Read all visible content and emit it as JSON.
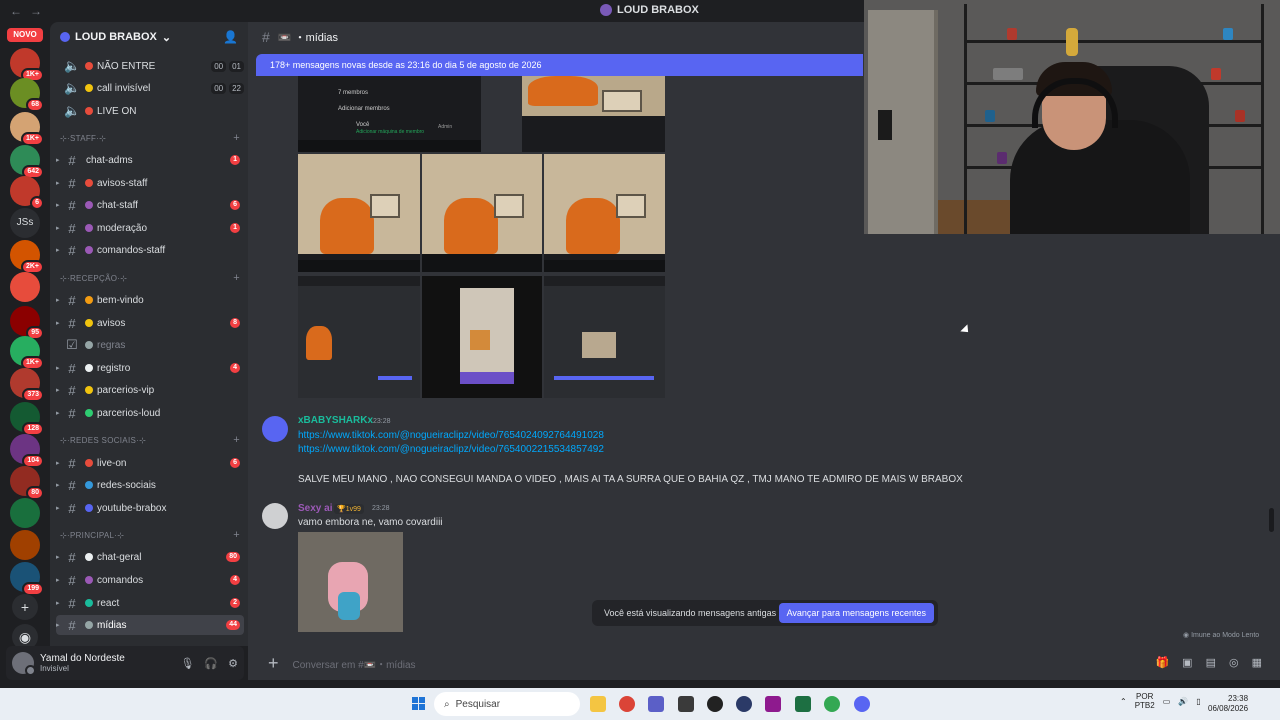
{
  "window": {
    "title": "LOUD BRABOX",
    "nav_back": "←",
    "nav_forward": "→"
  },
  "rail": {
    "new_label": "NOVO",
    "servers": [
      {
        "badge": "1K+",
        "color": "#c0392b"
      },
      {
        "badge": "68",
        "color": "#6b8e23"
      },
      {
        "badge": "1K+",
        "color": "#d4a373"
      },
      {
        "badge": "642",
        "color": "#2e8b57"
      },
      {
        "badge": "6",
        "color": "#c0392b"
      },
      {
        "badge": "",
        "text": "JSs"
      },
      {
        "badge": "2K+",
        "color": "#d35400"
      },
      {
        "badge": "",
        "color": "#e74c3c"
      },
      {
        "badge": "95",
        "color": "#8b0000"
      },
      {
        "badge": "1K+",
        "color": "#27ae60"
      },
      {
        "badge": "373",
        "color": "#b03a2e"
      },
      {
        "badge": "128",
        "color": "#145a32"
      },
      {
        "badge": "104",
        "color": "#6c3483"
      },
      {
        "badge": "80",
        "color": "#922b21"
      },
      {
        "badge": "",
        "color": "#196f3d"
      },
      {
        "badge": "",
        "color": "#a04000"
      },
      {
        "badge": "199",
        "color": "#1a5276"
      }
    ],
    "add_label": "+",
    "discover_label": "◉"
  },
  "sidebar": {
    "server_name": "LOUD BRABOX",
    "channels": [
      {
        "type": "voice",
        "label": "NÃO ENTRE",
        "c1": "00",
        "c2": "01",
        "emoji": "#e74c3c"
      },
      {
        "type": "voice",
        "label": "call invisível",
        "c1": "00",
        "c2": "22",
        "emoji": "#f1c40f"
      },
      {
        "type": "voice",
        "label": "LIVE ON",
        "emoji": "#e74c3c"
      },
      {
        "type": "cat",
        "label": "⊹·STAFF·⊹"
      },
      {
        "type": "text",
        "label": "chat-adms",
        "count": "1"
      },
      {
        "type": "text",
        "label": "avisos-staff",
        "emoji": "#e74c3c"
      },
      {
        "type": "text",
        "label": "chat-staff",
        "count": "6",
        "emoji": "#9b59b6"
      },
      {
        "type": "text",
        "label": "moderação",
        "count": "1",
        "emoji": "#9b59b6"
      },
      {
        "type": "text",
        "label": "comandos-staff",
        "emoji": "#9b59b6"
      },
      {
        "type": "cat",
        "label": "⊹·RECEPÇÃO·⊹"
      },
      {
        "type": "text",
        "label": "bem-vindo",
        "emoji": "#f39c12"
      },
      {
        "type": "text",
        "label": "avisos",
        "count": "8",
        "emoji": "#f1c40f"
      },
      {
        "type": "rules",
        "label": "regras",
        "emoji": "#95a5a6"
      },
      {
        "type": "text",
        "label": "registro",
        "count": "4",
        "emoji": "#ecf0f1"
      },
      {
        "type": "text",
        "label": "parcerios-vip",
        "emoji": "#f1c40f"
      },
      {
        "type": "text",
        "label": "parcerios-loud",
        "emoji": "#2ecc71"
      },
      {
        "type": "cat",
        "label": "⊹·REDES SOCIAIS·⊹"
      },
      {
        "type": "text",
        "label": "live-on",
        "count": "6",
        "emoji": "#e74c3c"
      },
      {
        "type": "text",
        "label": "redes-sociais",
        "emoji": "#3498db"
      },
      {
        "type": "text",
        "label": "youtube-brabox",
        "emoji": "#5865f2"
      },
      {
        "type": "cat",
        "label": "⊹·PRINCIPAL·⊹"
      },
      {
        "type": "text",
        "label": "chat-geral",
        "count": "80",
        "emoji": "#ecf0f1"
      },
      {
        "type": "text",
        "label": "comandos",
        "count": "4",
        "emoji": "#9b59b6"
      },
      {
        "type": "text",
        "label": "react",
        "count": "2",
        "emoji": "#1abc9c"
      },
      {
        "type": "text",
        "label": "mídias",
        "count": "44",
        "active": true,
        "emoji": "#95a5a6"
      }
    ]
  },
  "user": {
    "name": "Yamal do Nordeste",
    "status": "Invisível"
  },
  "chat": {
    "channel": "mídias",
    "new_messages": "178+ mensagens novas desde as 23:16 do dia 5 de agosto de 2026",
    "thumb_text": {
      "members": "7 membros",
      "add": "Adicionar membros",
      "you": "Você",
      "admin": "Admin",
      "invite": "Adicionar máquina de membro"
    },
    "messages": [
      {
        "author": "xBABYSHARKx",
        "time": "23:28",
        "links": [
          "https://www.tiktok.com/@nogueiraclipz/video/7654024092764491028",
          "https://www.tiktok.com/@nogueiraclipz/video/7654002215534857492"
        ],
        "text": "SALVE MEU MANO , NAO CONSEGUI MANDA O VIDEO , MAIS AI TA A SURRA QUE O BAHIA QZ , TMJ MANO TE ADMIRO DE MAIS W BRABOX"
      },
      {
        "author": "Sexy ai",
        "badge": "🏆1v99",
        "time": "23:28",
        "text": "vamo embora ne, vamo covardiii"
      }
    ],
    "old_notice": "Você está visualizando mensagens antigas",
    "jump_label": "Avançar para mensagens recentes",
    "slow_mode": "Imune ao Modo Lento",
    "composer_placeholder": "Conversar em #📼・mídias"
  },
  "taskbar": {
    "search_placeholder": "Pesquisar",
    "lang_line1": "POR",
    "lang_line2": "PTB2",
    "time": "23:38",
    "date": "06/08/2026"
  }
}
